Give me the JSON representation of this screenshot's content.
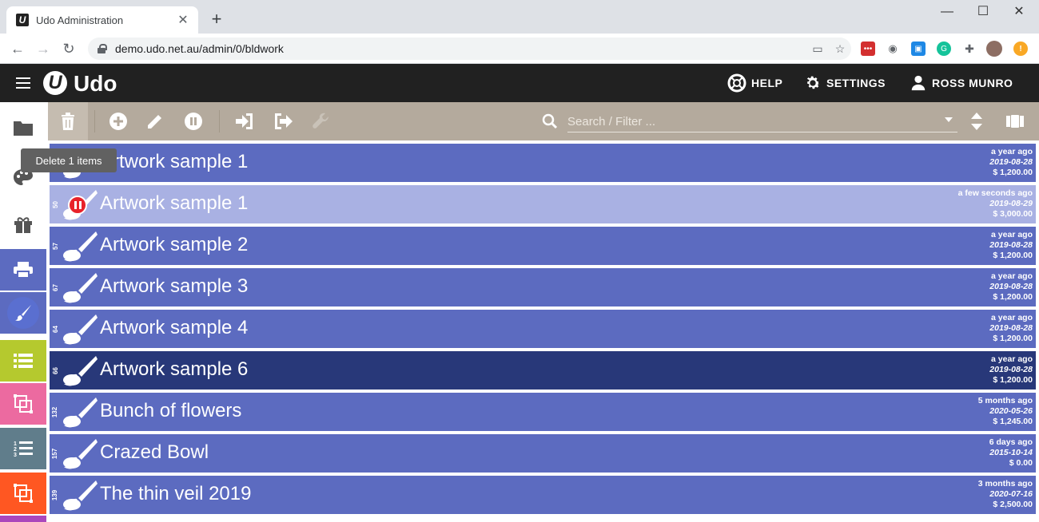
{
  "browser": {
    "tab_title": "Udo Administration",
    "url": "demo.udo.net.au/admin/0/bldwork"
  },
  "app": {
    "logo_text": "Udo",
    "logo_mark": "U",
    "help_label": "HELP",
    "settings_label": "SETTINGS",
    "user_label": "ROSS MUNRO"
  },
  "toolbar": {
    "search_placeholder": "Search / Filter ...",
    "tooltip": "Delete 1 items"
  },
  "sidebar": {
    "items": [
      {
        "icon": "folder-icon",
        "color": "#ffffff"
      },
      {
        "icon": "palette-icon",
        "color": "#ffffff"
      },
      {
        "icon": "gift-icon",
        "color": "#ffffff"
      },
      {
        "icon": "printer-icon",
        "color": "#5c6bc0"
      },
      {
        "icon": "brush-icon",
        "color": "#5c6bc0"
      },
      {
        "icon": "list-icon",
        "color": "#b5c92e"
      },
      {
        "icon": "crop-icon",
        "color": "#ec6aa0"
      },
      {
        "icon": "numbered-list-icon",
        "color": "#607d8b"
      },
      {
        "icon": "crop-icon",
        "color": "#ff5722"
      }
    ]
  },
  "rows": [
    {
      "id": "",
      "title": "Artwork sample 1",
      "ago": "a year ago",
      "date": "2019-08-28",
      "price": "$ 1,200.00",
      "state": "normal"
    },
    {
      "id": "50",
      "title": "Artwork sample 1",
      "ago": "a few seconds ago",
      "date": "2019-08-29",
      "price": "$ 3,000.00",
      "state": "paused"
    },
    {
      "id": "57",
      "title": "Artwork sample 2",
      "ago": "a year ago",
      "date": "2019-08-28",
      "price": "$ 1,200.00",
      "state": "normal"
    },
    {
      "id": "67",
      "title": "Artwork sample 3",
      "ago": "a year ago",
      "date": "2019-08-28",
      "price": "$ 1,200.00",
      "state": "normal"
    },
    {
      "id": "64",
      "title": "Artwork sample 4",
      "ago": "a year ago",
      "date": "2019-08-28",
      "price": "$ 1,200.00",
      "state": "normal"
    },
    {
      "id": "66",
      "title": "Artwork sample 6",
      "ago": "a year ago",
      "date": "2019-08-28",
      "price": "$ 1,200.00",
      "state": "selected"
    },
    {
      "id": "132",
      "title": "Bunch of flowers",
      "ago": "5 months ago",
      "date": "2020-05-26",
      "price": "$ 1,245.00",
      "state": "normal"
    },
    {
      "id": "157",
      "title": "Crazed Bowl",
      "ago": "6 days ago",
      "date": "2015-10-14",
      "price": "$ 0.00",
      "state": "normal"
    },
    {
      "id": "139",
      "title": "The thin veil 2019",
      "ago": "3 months ago",
      "date": "2020-07-16",
      "price": "$ 2,500.00",
      "state": "normal"
    }
  ],
  "colors": {
    "row": "#5c6bc0",
    "row_selected": "#283879",
    "row_paused": "#a9b1e3",
    "toolbar": "#b4aa9d",
    "appbar": "#212121"
  }
}
